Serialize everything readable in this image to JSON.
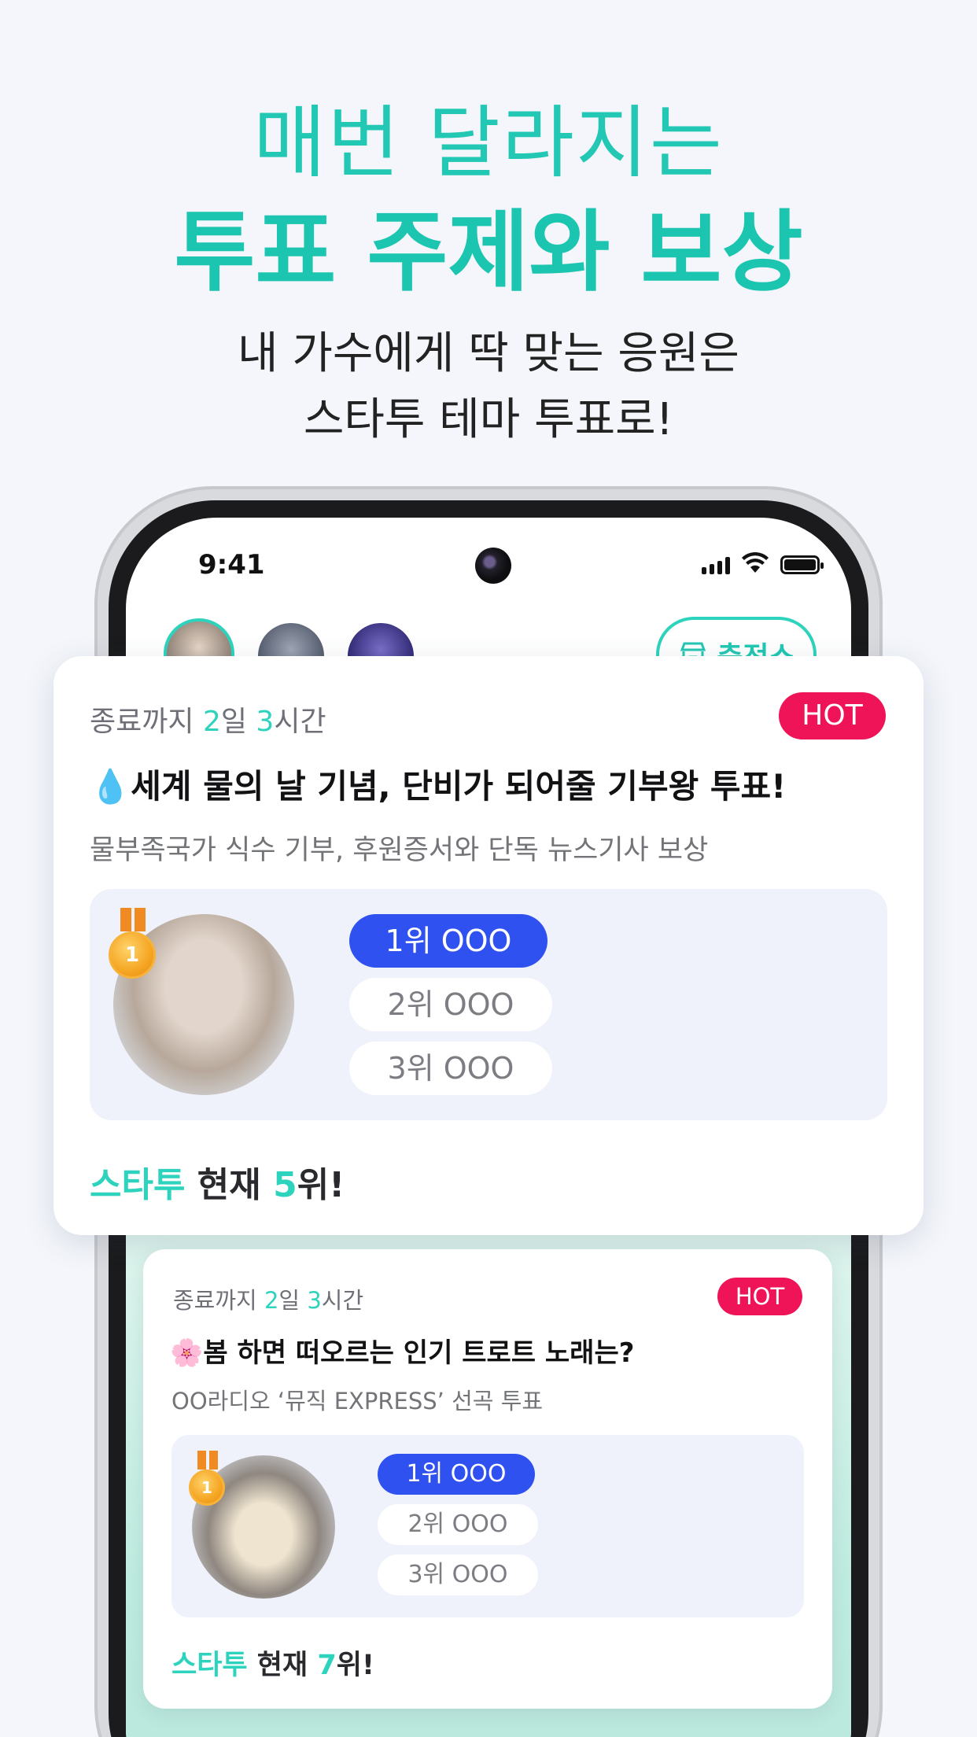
{
  "header": {
    "line1": "매번 달라지는",
    "line2": "투표 주제와 보상",
    "sub1": "내 가수에게 딱 맞는 응원은",
    "sub2": "스타투 테마 투표로!"
  },
  "status_bar": {
    "time": "9:41"
  },
  "top_bar": {
    "charge_button": "충전소"
  },
  "cards": [
    {
      "deadline_prefix": "종료까지 ",
      "days": "2",
      "days_unit": "일 ",
      "hours": "3",
      "hours_unit": "시간",
      "hot": "HOT",
      "title": "💧세계 물의 날 기념, 단비가 되어줄 기부왕 투표!",
      "description": "물부족국가 식수 기부, 후원증서와 단독 뉴스기사 보상",
      "medal": "1",
      "ranks": [
        "1위 OOO",
        "2위 OOO",
        "3위 OOO"
      ],
      "current_brand": "스타투",
      "current_mid": " 현재 ",
      "current_rank": "5",
      "current_suffix": "위!"
    },
    {
      "deadline_prefix": "종료까지 ",
      "days": "2",
      "days_unit": "일 ",
      "hours": "3",
      "hours_unit": "시간",
      "hot": "HOT",
      "title": "🌸봄 하면 떠오르는 인기 트로트 노래는?",
      "description": "OO라디오 ‘뮤직 EXPRESS’ 선곡 투표",
      "medal": "1",
      "ranks": [
        "1위 OOO",
        "2위 OOO",
        "3위 OOO"
      ],
      "current_brand": "스타투",
      "current_mid": " 현재 ",
      "current_rank": "7",
      "current_suffix": "위!"
    }
  ]
}
